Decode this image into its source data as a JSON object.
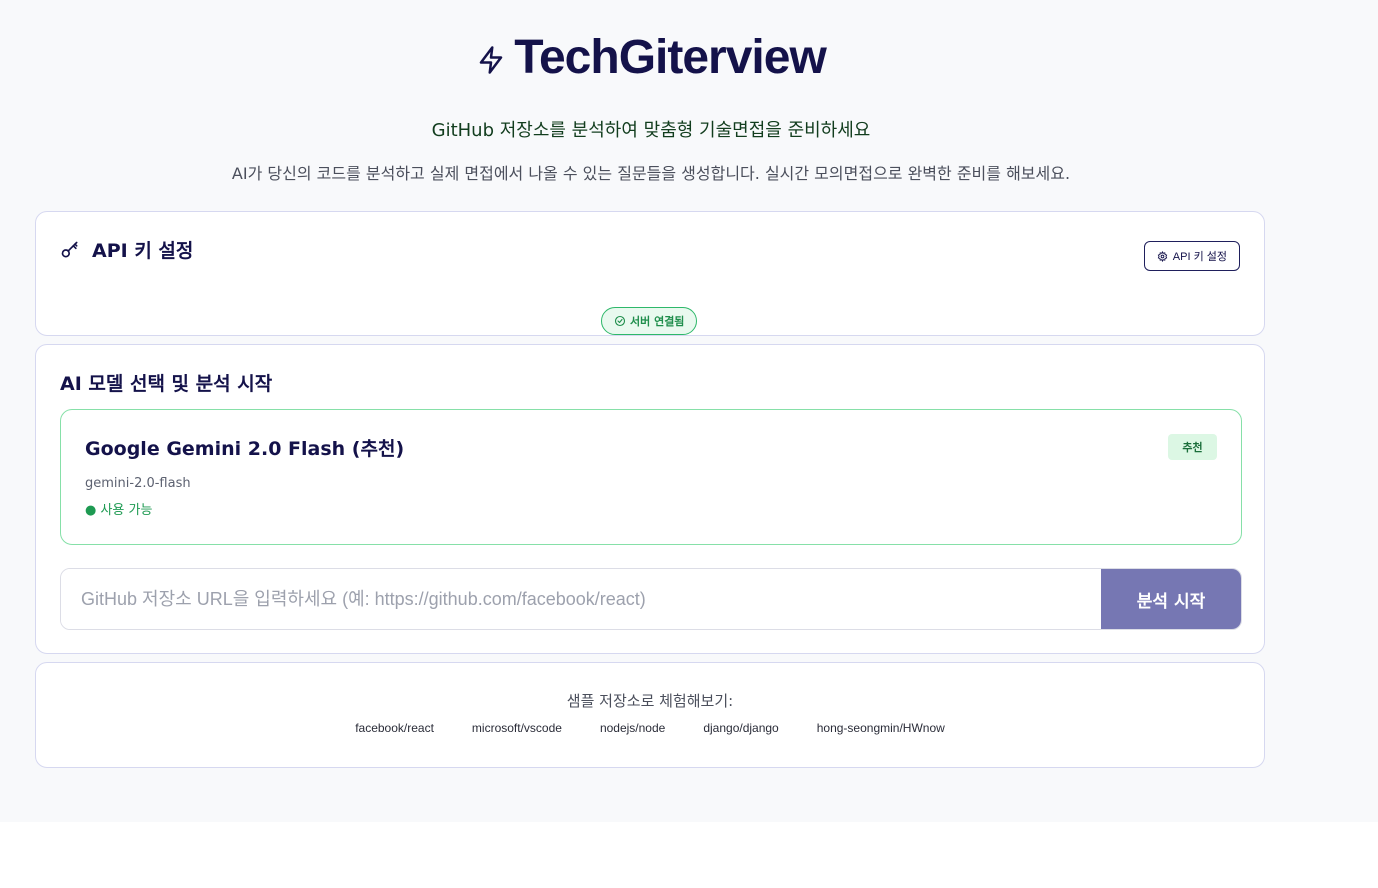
{
  "header": {
    "title": "TechGiterview",
    "subtitle": "GitHub 저장소를 분석하여 맞춤형 기술면접을 준비하세요",
    "description": "AI가 당신의 코드를 분석하고 실제 면접에서 나올 수 있는 질문들을 생성합니다. 실시간 모의면접으로 완벽한 준비를 해보세요.",
    "title_icon": "bolt-icon"
  },
  "api_section": {
    "title": "API 키 설정",
    "title_icon": "key-icon",
    "settings_button_label": "API 키 설정",
    "settings_button_icon": "gear-icon",
    "status_label": "서버 연결됨",
    "status_icon": "check-circle-icon"
  },
  "model_section": {
    "title": "AI 모델 선택 및 분석 시작",
    "selected_model": {
      "name": "Google Gemini 2.0 Flash (추천)",
      "id": "gemini-2.0-flash",
      "availability": "● 사용 가능",
      "badge": "추천"
    },
    "repo_input": {
      "value": "",
      "placeholder": "GitHub 저장소 URL을 입력하세요 (예: https://github.com/facebook/react)"
    },
    "analyze_button_label": "분석 시작"
  },
  "samples": {
    "label": "샘플 저장소로 체험해보기:",
    "items": [
      "facebook/react",
      "microsoft/vscode",
      "nodejs/node",
      "django/django",
      "hong-seongmin/HWnow"
    ]
  },
  "colors": {
    "accent": "#7677b3",
    "title": "#14124a",
    "success": "#1e9a52",
    "success_border": "#86e0a8",
    "background": "#f8f9fb"
  }
}
